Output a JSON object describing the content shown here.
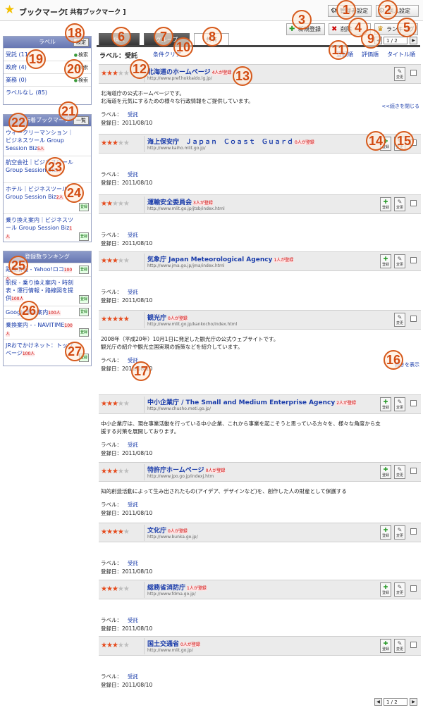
{
  "title": "ブックマーク",
  "subtitle": "[ 共有ブックマーク ]",
  "toolbar": {
    "admin": "管理者設定",
    "personal": "個人設定",
    "new": "新規登録",
    "delete": "削除",
    "ranking": "ランキング"
  },
  "tabs": [
    "個人",
    "グループ",
    "共有"
  ],
  "pager_top": {
    "page": "1 / 2"
  },
  "pager_bottom": {
    "page": "1 / 2"
  },
  "sort": {
    "label_prefix": "ラベル：受託",
    "clear": "条件クリア",
    "order1": "登録順",
    "order2": "評価順",
    "order3": "タイトル順"
  },
  "sidebar": {
    "labels_title": "ラベル",
    "labels_setting": "設定",
    "labels": [
      {
        "name": "受託 (11)",
        "action": "検索"
      },
      {
        "name": "政府 (4)",
        "action": "検索"
      },
      {
        "name": "業務 (0)",
        "action": "検索"
      },
      {
        "name": "ラベルなし (85)",
        "action": ""
      }
    ],
    "new_title": "新着ブックマーク",
    "new_list_btn": "一覧",
    "new_items": [
      {
        "text": "ウィークリーマンション｜ビジネスツール Group Session Biz",
        "badge": "5人"
      },
      {
        "text": "航空会社｜ビジネスツール Group Session Biz",
        "badge": "2人"
      },
      {
        "text": "ホテル｜ビジネスツール Group Session Biz",
        "badge": "2人"
      },
      {
        "text": "乗り換え案内｜ビジネスツール Group Session Biz",
        "badge": "1人"
      }
    ],
    "rank_title": "登録数ランキング",
    "rank_items": [
      {
        "text": "路線情報 - Yahoo!ロコ",
        "badge": "100人"
      },
      {
        "text": "駅探 - 乗り換え案内・時刻表・運行情報・路線図を提供",
        "badge": "100人"
      },
      {
        "text": "Google乗換案内",
        "badge": "100人"
      },
      {
        "text": "乗換案内 - - NAVITIME",
        "badge": "100人"
      },
      {
        "text": "JRおでかけネット：トップページ",
        "badge": "100人"
      }
    ],
    "register_btn": "登録"
  },
  "entries": [
    {
      "stars": 3,
      "title": "北海道のホームページ",
      "count": "4人が登録",
      "url": "http://www.pref.hokkaido.lg.jp/",
      "desc": "北海道庁の公式ホームページです。\n北海道を元気にするための様々な行政情報をご提供しています。",
      "toggle": "<<続きを閉じる",
      "label": "受託",
      "date": "2011/08/10"
    },
    {
      "stars": 3,
      "title": "海上保安庁　Ｊａｐａｎ　Ｃｏａｓｔ　Ｇｕａｒｄ",
      "count": "0人が登録",
      "url": "http://www.kaiho.mlit.go.jp/",
      "desc": "",
      "toggle": "",
      "label": "受託",
      "date": "2011/08/10"
    },
    {
      "stars": 2,
      "title": "運輸安全委員会",
      "count": "3人が登録",
      "url": "http://www.mlit.go.jp/jtsb/index.html",
      "desc": "",
      "toggle": "",
      "label": "受託",
      "date": "2011/08/10"
    },
    {
      "stars": 3,
      "title": "気象庁 Japan Meteorological Agency",
      "count": "1人が登録",
      "url": "http://www.jma.go.jp/jma/index.html",
      "desc": "",
      "toggle": "",
      "label": "受託",
      "date": "2011/08/10"
    },
    {
      "stars": 5,
      "title": "観光庁",
      "count": "0人が登録",
      "url": "http://www.mlit.go.jp/kankocho/index.html",
      "desc": "2008年（平成20年）10月1日に発足した観光庁の公式ウェブサイトです。\n観光庁の紹介や観光立国実現の施策などを紹介しています。",
      "toggle": "続きを表示",
      "label": "受託",
      "date": "2011/08/10"
    },
    {
      "stars": 3,
      "title": "中小企業庁 / The Small and Medium Enterprise Agency",
      "count": "2人が登録",
      "url": "http://www.chusho.meti.go.jp/",
      "desc": "中小企業庁は、現在事業活動を行っている中小企業、これから事業を起こそうと思っている方々を、様々な角度から支援する対策を展開しております。",
      "toggle": "",
      "label": "受託",
      "date": "2011/08/10"
    },
    {
      "stars": 3,
      "title": "特許庁ホームページ",
      "count": "0人が登録",
      "url": "http://www.jpo.go.jp/indexj.htm",
      "desc": "知的創造活動によって生み出されたもの(アイデア、デザインなど)を、創作した人の財産として保護する",
      "toggle": "",
      "label": "受託",
      "date": "2011/08/10"
    },
    {
      "stars": 4,
      "title": "文化庁",
      "count": "0人が登録",
      "url": "http://www.bunka.go.jp/",
      "desc": "",
      "toggle": "",
      "label": "受託",
      "date": "2011/08/10"
    },
    {
      "stars": 3,
      "title": "総務省消防庁",
      "count": "1人が登録",
      "url": "http://www.fdma.go.jp/",
      "desc": "",
      "toggle": "",
      "label": "受託",
      "date": "2011/08/10"
    },
    {
      "stars": 3,
      "title": "国土交通省",
      "count": "0人が登録",
      "url": "http://www.mlit.go.jp/",
      "desc": "",
      "toggle": "",
      "label": "受託",
      "date": "2011/08/10"
    }
  ],
  "entry_labels": {
    "label": "ラベル：",
    "date": "登録日：",
    "register": "登録",
    "edit": "変更"
  },
  "callouts": [
    "1",
    "2",
    "3",
    "4",
    "5",
    "6",
    "7",
    "8",
    "9",
    "10",
    "11",
    "12",
    "13",
    "14",
    "15",
    "16",
    "17",
    "18",
    "19",
    "20",
    "21",
    "22",
    "23",
    "24",
    "25",
    "26",
    "27"
  ],
  "colors": {
    "accent": "#1a3caa",
    "callout": "#d65a1c",
    "star": "#e54a1c",
    "header": "#6676b2"
  }
}
